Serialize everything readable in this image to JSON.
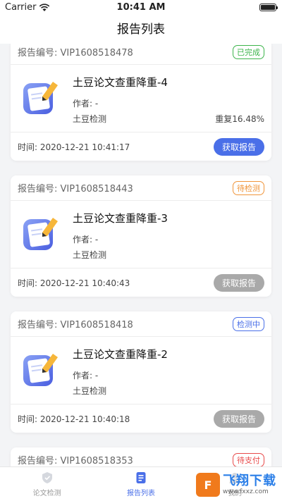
{
  "status_bar": {
    "carrier": "Carrier",
    "time": "10:41 AM"
  },
  "nav": {
    "title": "报告列表"
  },
  "labels": {
    "report_no_prefix": "报告编号: ",
    "time_prefix": "时间: "
  },
  "colors": {
    "accent": "#4a6fe8",
    "disabled": "#a9a9a9",
    "done": "#3cb44b",
    "pending": "#f0953a",
    "checking": "#4a6fe8",
    "unpaid": "#e84a4a"
  },
  "reports": [
    {
      "report_no": "VIP1608518478",
      "status": "已完成",
      "status_color": "#3cb44b",
      "title": "土豆论文查重降重-4",
      "author": "作者: -",
      "source": "土豆检测",
      "repeat": "重复16.48%",
      "time": "2020-12-21 10:41:17",
      "button": "获取报告",
      "button_color": "#4a6fe8"
    },
    {
      "report_no": "VIP1608518443",
      "status": "待检测",
      "status_color": "#f0953a",
      "title": "土豆论文查重降重-3",
      "author": "作者: -",
      "source": "土豆检测",
      "repeat": "",
      "time": "2020-12-21 10:40:43",
      "button": "获取报告",
      "button_color": "#a9a9a9"
    },
    {
      "report_no": "VIP1608518418",
      "status": "检测中",
      "status_color": "#4a6fe8",
      "title": "土豆论文查重降重-2",
      "author": "作者: -",
      "source": "土豆检测",
      "repeat": "",
      "time": "2020-12-21 10:40:18",
      "button": "获取报告",
      "button_color": "#a9a9a9"
    },
    {
      "report_no": "VIP1608518353",
      "status": "待支付",
      "status_color": "#e84a4a",
      "title": "",
      "author": "",
      "source": "",
      "repeat": "",
      "time": "",
      "button": "",
      "button_color": "#a9a9a9"
    }
  ],
  "tabs": [
    {
      "label": "论文检测",
      "active": false,
      "icon": "shield-icon"
    },
    {
      "label": "报告列表",
      "active": true,
      "icon": "document-list-icon"
    },
    {
      "label": "我的",
      "active": false,
      "icon": "user-icon"
    }
  ],
  "watermark": {
    "logo": "F",
    "main": "飞翔下载",
    "sub": "www.fxxz.com"
  }
}
